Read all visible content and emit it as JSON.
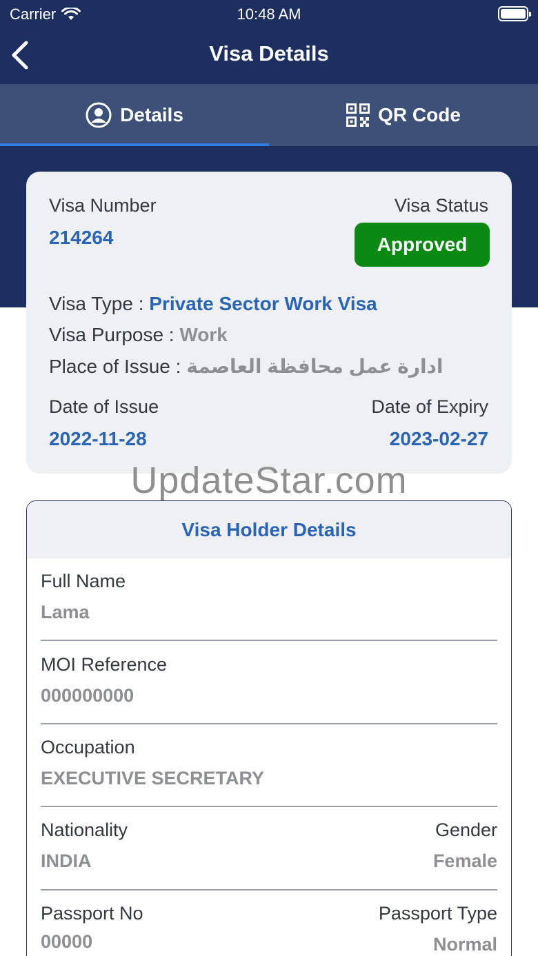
{
  "status_bar": {
    "carrier": "Carrier",
    "time": "10:48 AM"
  },
  "nav": {
    "title": "Visa Details"
  },
  "tabs": [
    {
      "label": "Details",
      "icon": "user-circle-icon",
      "active": true
    },
    {
      "label": "QR Code",
      "icon": "qr-code-icon",
      "active": false
    }
  ],
  "visa": {
    "number_label": "Visa Number",
    "number": "214264",
    "status_label": "Visa Status",
    "status": "Approved",
    "type_label": "Visa Type : ",
    "type": "Private Sector Work Visa",
    "purpose_label": "Visa Purpose : ",
    "purpose": "Work",
    "place_label": "Place of Issue : ",
    "place": "ادارة عمل محافظة العاصمة",
    "issue_label": "Date of Issue",
    "issue_date": "2022-11-28",
    "expiry_label": "Date of Expiry",
    "expiry_date": "2023-02-27"
  },
  "watermark": "UpdateStar.com",
  "holder": {
    "heading": "Visa Holder Details",
    "full_name_label": "Full Name",
    "full_name": "Lama",
    "moi_label": "MOI Reference",
    "moi": "000000000",
    "occupation_label": "Occupation",
    "occupation": "EXECUTIVE SECRETARY",
    "nationality_label": "Nationality",
    "nationality": "INDIA",
    "gender_label": "Gender",
    "gender": "Female",
    "passport_no_label": "Passport No",
    "passport_no": "00000",
    "passport_type_label": "Passport Type",
    "passport_type": "Normal"
  },
  "colors": {
    "navy": "#1d2f5e",
    "tab_bar": "#3d5078",
    "accent_blue": "#2a64b5",
    "approved_green": "#0a8a12"
  }
}
